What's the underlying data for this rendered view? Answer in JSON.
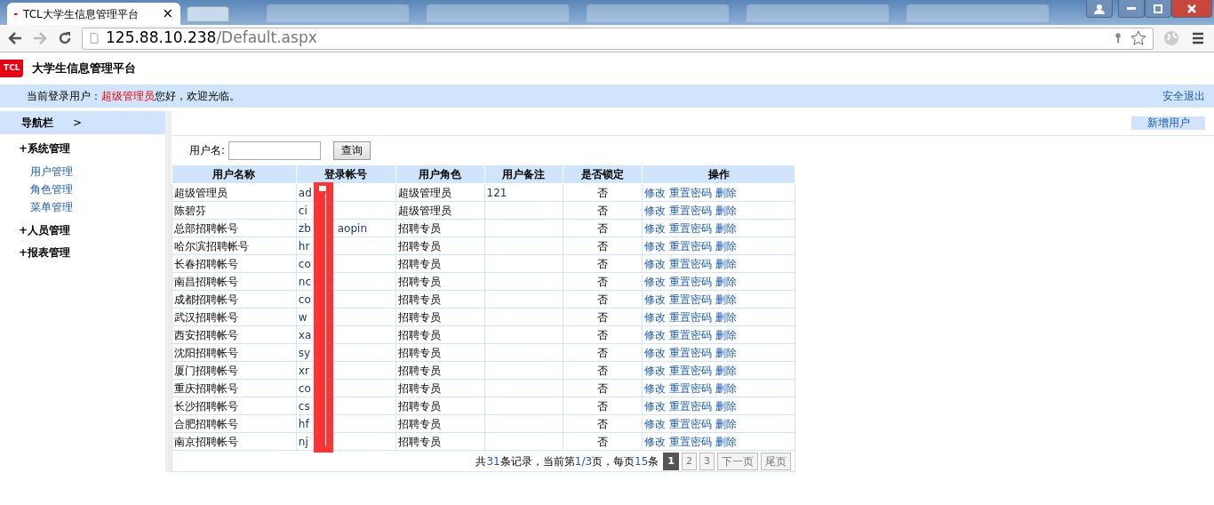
{
  "browser": {
    "tab_title": "TCL大学生信息管理平台",
    "tab_close": "×",
    "url_host": "125.88.10.238",
    "url_path": "/Default.aspx"
  },
  "header": {
    "logo": "TCL",
    "title": "大学生信息管理平台"
  },
  "user_bar": {
    "label": "当前登录用户：",
    "user": "超级管理员",
    "greeting": "您好，欢迎光临。",
    "logout": "安全退出"
  },
  "sidebar": {
    "title": "导航栏",
    "toggle": ">",
    "groups": [
      {
        "label": "系统管理",
        "marker": "+",
        "children": [
          {
            "label": "用户管理"
          },
          {
            "label": "角色管理"
          },
          {
            "label": "菜单管理"
          }
        ]
      },
      {
        "label": "人员管理",
        "marker": "+"
      },
      {
        "label": "报表管理",
        "marker": "+"
      }
    ]
  },
  "toolbar": {
    "add_button": "新增用户"
  },
  "search": {
    "label": "用户名:",
    "button": "查询"
  },
  "table": {
    "columns": [
      "用户名称",
      "登录帐号",
      "用户角色",
      "用户备注",
      "是否锁定",
      "操作"
    ],
    "rows": [
      {
        "name": "超级管理员",
        "account": "ad",
        "role": "超级管理员",
        "note": "121",
        "locked": "否",
        "actions": [
          "修改",
          "重置密码",
          "删除"
        ]
      },
      {
        "name": "陈碧芬",
        "account": "ci",
        "role": "超级管理员",
        "locked": "否",
        "actions": [
          "修改",
          "重置密码",
          "删除"
        ]
      },
      {
        "name": "总部招聘帐号",
        "account": "zb",
        "account_tail": "aopin",
        "role": "招聘专员",
        "locked": "否",
        "actions": [
          "修改",
          "重置密码",
          "删除"
        ]
      },
      {
        "name": "哈尔滨招聘帐号",
        "account": "hr",
        "role": "招聘专员",
        "locked": "否",
        "actions": [
          "修改",
          "重置密码",
          "删除"
        ]
      },
      {
        "name": "长春招聘帐号",
        "account": "co",
        "role": "招聘专员",
        "locked": "否",
        "actions": [
          "修改",
          "重置密码",
          "删除"
        ]
      },
      {
        "name": "南昌招聘帐号",
        "account": "nc",
        "role": "招聘专员",
        "locked": "否",
        "actions": [
          "修改",
          "重置密码",
          "删除"
        ]
      },
      {
        "name": "成都招聘帐号",
        "account": "co",
        "role": "招聘专员",
        "locked": "否",
        "actions": [
          "修改",
          "重置密码",
          "删除"
        ]
      },
      {
        "name": "武汉招聘帐号",
        "account": "w",
        "role": "招聘专员",
        "locked": "否",
        "actions": [
          "修改",
          "重置密码",
          "删除"
        ]
      },
      {
        "name": "西安招聘帐号",
        "account": "xa",
        "role": "招聘专员",
        "locked": "否",
        "actions": [
          "修改",
          "重置密码",
          "删除"
        ]
      },
      {
        "name": "沈阳招聘帐号",
        "account": "sy",
        "role": "招聘专员",
        "locked": "否",
        "actions": [
          "修改",
          "重置密码",
          "删除"
        ]
      },
      {
        "name": "厦门招聘帐号",
        "account": "xr",
        "role": "招聘专员",
        "locked": "否",
        "actions": [
          "修改",
          "重置密码",
          "删除"
        ]
      },
      {
        "name": "重庆招聘帐号",
        "account": "co",
        "role": "招聘专员",
        "locked": "否",
        "actions": [
          "修改",
          "重置密码",
          "删除"
        ]
      },
      {
        "name": "长沙招聘帐号",
        "account": "cs",
        "role": "招聘专员",
        "locked": "否",
        "actions": [
          "修改",
          "重置密码",
          "删除"
        ]
      },
      {
        "name": "合肥招聘帐号",
        "account": "hf",
        "role": "招聘专员",
        "locked": "否",
        "actions": [
          "修改",
          "重置密码",
          "删除"
        ]
      },
      {
        "name": "南京招聘帐号",
        "account": "nj",
        "role": "招聘专员",
        "locked": "否",
        "actions": [
          "修改",
          "重置密码",
          "删除"
        ]
      }
    ]
  },
  "pagination": {
    "summary": [
      {
        "text": "共"
      },
      {
        "text": "31",
        "highlight": true
      },
      {
        "text": "条记录，当前第"
      },
      {
        "text": "1/3",
        "highlight": true
      },
      {
        "text": "页，每页"
      },
      {
        "text": "15",
        "highlight": true
      },
      {
        "text": "条"
      }
    ],
    "pages": [
      {
        "label": "1",
        "selected": true
      },
      {
        "label": "2",
        "selected": false
      },
      {
        "label": "3",
        "selected": false
      }
    ],
    "buttons": [
      "下一页",
      "尾页"
    ]
  }
}
